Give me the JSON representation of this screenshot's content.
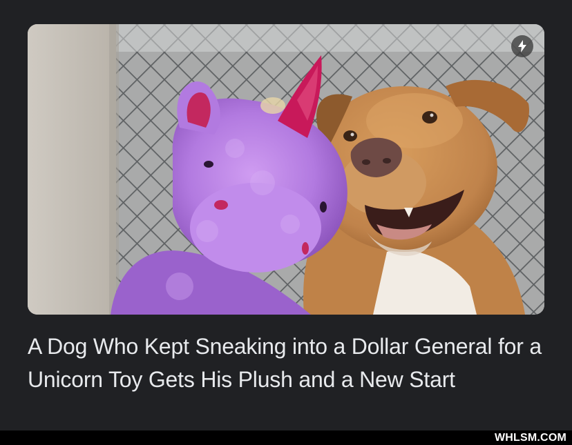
{
  "article": {
    "headline": "A Dog Who Kept Sneaking into a Dollar General for a Unicorn Toy Gets His Plush and a New Start",
    "image_subject": "dog-with-purple-unicorn-plush",
    "badge_icon": "amp-lightning-icon"
  },
  "watermark": {
    "text": "WHLSM.COM"
  },
  "colors": {
    "background": "#202124",
    "headline_text": "#e8eaed",
    "plush_purple": "#b57be0",
    "horn_pink": "#c8195a",
    "dog_tan": "#c98c4f"
  }
}
